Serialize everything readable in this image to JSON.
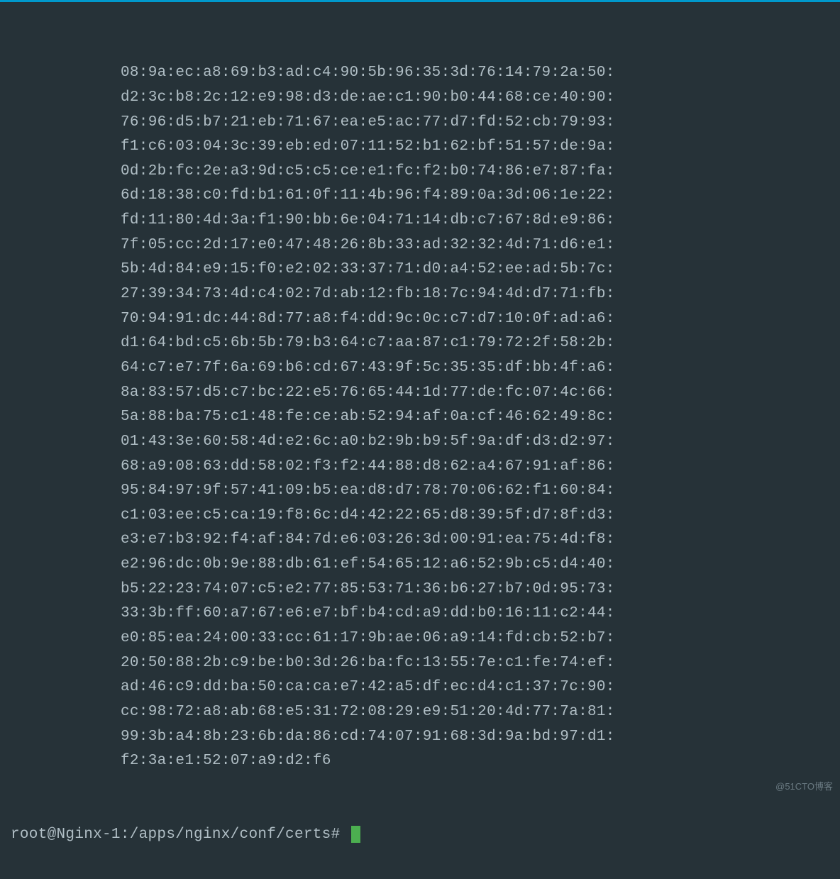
{
  "hex_lines": [
    "08:9a:ec:a8:69:b3:ad:c4:90:5b:96:35:3d:76:14:79:2a:50:",
    "d2:3c:b8:2c:12:e9:98:d3:de:ae:c1:90:b0:44:68:ce:40:90:",
    "76:96:d5:b7:21:eb:71:67:ea:e5:ac:77:d7:fd:52:cb:79:93:",
    "f1:c6:03:04:3c:39:eb:ed:07:11:52:b1:62:bf:51:57:de:9a:",
    "0d:2b:fc:2e:a3:9d:c5:c5:ce:e1:fc:f2:b0:74:86:e7:87:fa:",
    "6d:18:38:c0:fd:b1:61:0f:11:4b:96:f4:89:0a:3d:06:1e:22:",
    "fd:11:80:4d:3a:f1:90:bb:6e:04:71:14:db:c7:67:8d:e9:86:",
    "7f:05:cc:2d:17:e0:47:48:26:8b:33:ad:32:32:4d:71:d6:e1:",
    "5b:4d:84:e9:15:f0:e2:02:33:37:71:d0:a4:52:ee:ad:5b:7c:",
    "27:39:34:73:4d:c4:02:7d:ab:12:fb:18:7c:94:4d:d7:71:fb:",
    "70:94:91:dc:44:8d:77:a8:f4:dd:9c:0c:c7:d7:10:0f:ad:a6:",
    "d1:64:bd:c5:6b:5b:79:b3:64:c7:aa:87:c1:79:72:2f:58:2b:",
    "64:c7:e7:7f:6a:69:b6:cd:67:43:9f:5c:35:35:df:bb:4f:a6:",
    "8a:83:57:d5:c7:bc:22:e5:76:65:44:1d:77:de:fc:07:4c:66:",
    "5a:88:ba:75:c1:48:fe:ce:ab:52:94:af:0a:cf:46:62:49:8c:",
    "01:43:3e:60:58:4d:e2:6c:a0:b2:9b:b9:5f:9a:df:d3:d2:97:",
    "68:a9:08:63:dd:58:02:f3:f2:44:88:d8:62:a4:67:91:af:86:",
    "95:84:97:9f:57:41:09:b5:ea:d8:d7:78:70:06:62:f1:60:84:",
    "c1:03:ee:c5:ca:19:f8:6c:d4:42:22:65:d8:39:5f:d7:8f:d3:",
    "e3:e7:b3:92:f4:af:84:7d:e6:03:26:3d:00:91:ea:75:4d:f8:",
    "e2:96:dc:0b:9e:88:db:61:ef:54:65:12:a6:52:9b:c5:d4:40:",
    "b5:22:23:74:07:c5:e2:77:85:53:71:36:b6:27:b7:0d:95:73:",
    "33:3b:ff:60:a7:67:e6:e7:bf:b4:cd:a9:dd:b0:16:11:c2:44:",
    "e0:85:ea:24:00:33:cc:61:17:9b:ae:06:a9:14:fd:cb:52:b7:",
    "20:50:88:2b:c9:be:b0:3d:26:ba:fc:13:55:7e:c1:fe:74:ef:",
    "ad:46:c9:dd:ba:50:ca:ca:e7:42:a5:df:ec:d4:c1:37:7c:90:",
    "cc:98:72:a8:ab:68:e5:31:72:08:29:e9:51:20:4d:77:7a:81:",
    "99:3b:a4:8b:23:6b:da:86:cd:74:07:91:68:3d:9a:bd:97:d1:",
    "f2:3a:e1:52:07:a9:d2:f6"
  ],
  "prompt": "root@Nginx-1:/apps/nginx/conf/certs# ",
  "watermark": "@51CTO博客"
}
